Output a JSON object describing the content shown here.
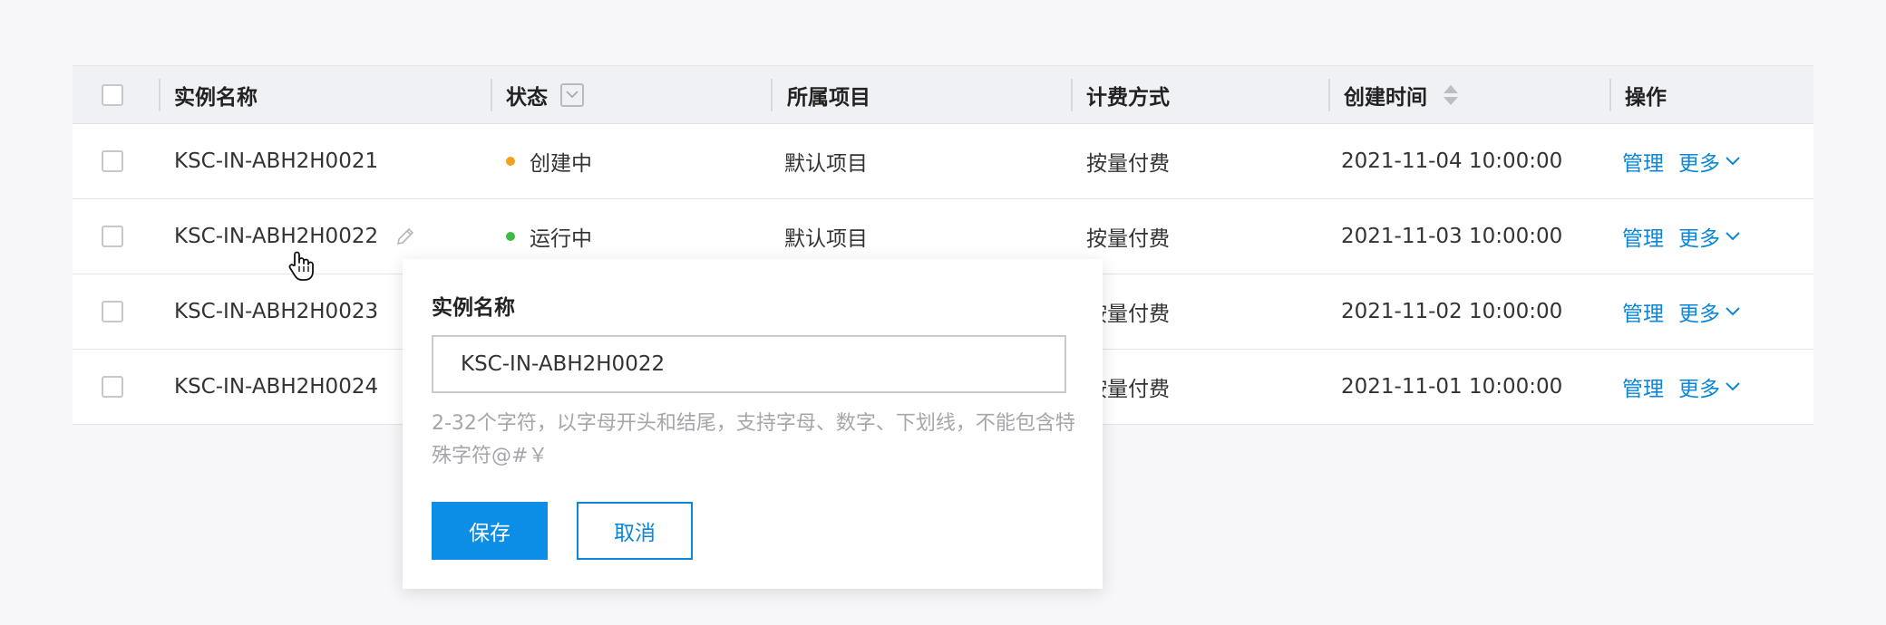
{
  "table": {
    "headers": {
      "name": "实例名称",
      "status": "状态",
      "project": "所属项目",
      "billing": "计费方式",
      "created": "创建时间",
      "ops": "操作"
    },
    "rows": [
      {
        "name": "KSC-IN-ABH2H0021",
        "status": "创建中",
        "status_color": "#f5a01a",
        "project": "默认项目",
        "billing": "按量付费",
        "created": "2021-11-04 10:00:00",
        "manage": "管理",
        "more": "更多"
      },
      {
        "name": "KSC-IN-ABH2H0022",
        "status": "运行中",
        "status_color": "#3dbb46",
        "project": "默认项目",
        "billing": "按量付费",
        "created": "2021-11-03 10:00:00",
        "manage": "管理",
        "more": "更多"
      },
      {
        "name": "KSC-IN-ABH2H0023",
        "billing": "按量付费",
        "created": "2021-11-02 10:00:00",
        "manage": "管理",
        "more": "更多"
      },
      {
        "name": "KSC-IN-ABH2H0024",
        "billing": "按量付费",
        "created": "2021-11-01 10:00:00",
        "manage": "管理",
        "more": "更多"
      }
    ]
  },
  "popover": {
    "title": "实例名称",
    "input_value": "KSC-IN-ABH2H0022",
    "hint": "2-32个字符，以字母开头和结尾，支持字母、数字、下划线，不能包含特殊字符@#￥",
    "save_label": "保存",
    "cancel_label": "取消"
  },
  "colors": {
    "accent": "#0b86d8",
    "primary_button": "#0c8ee6"
  },
  "icons": {
    "edit": "pencil-icon",
    "cursor": "hand-pointer-icon",
    "filter": "filter-box-icon",
    "sort": "sort-arrows-icon",
    "more": "chevron-down-icon"
  }
}
